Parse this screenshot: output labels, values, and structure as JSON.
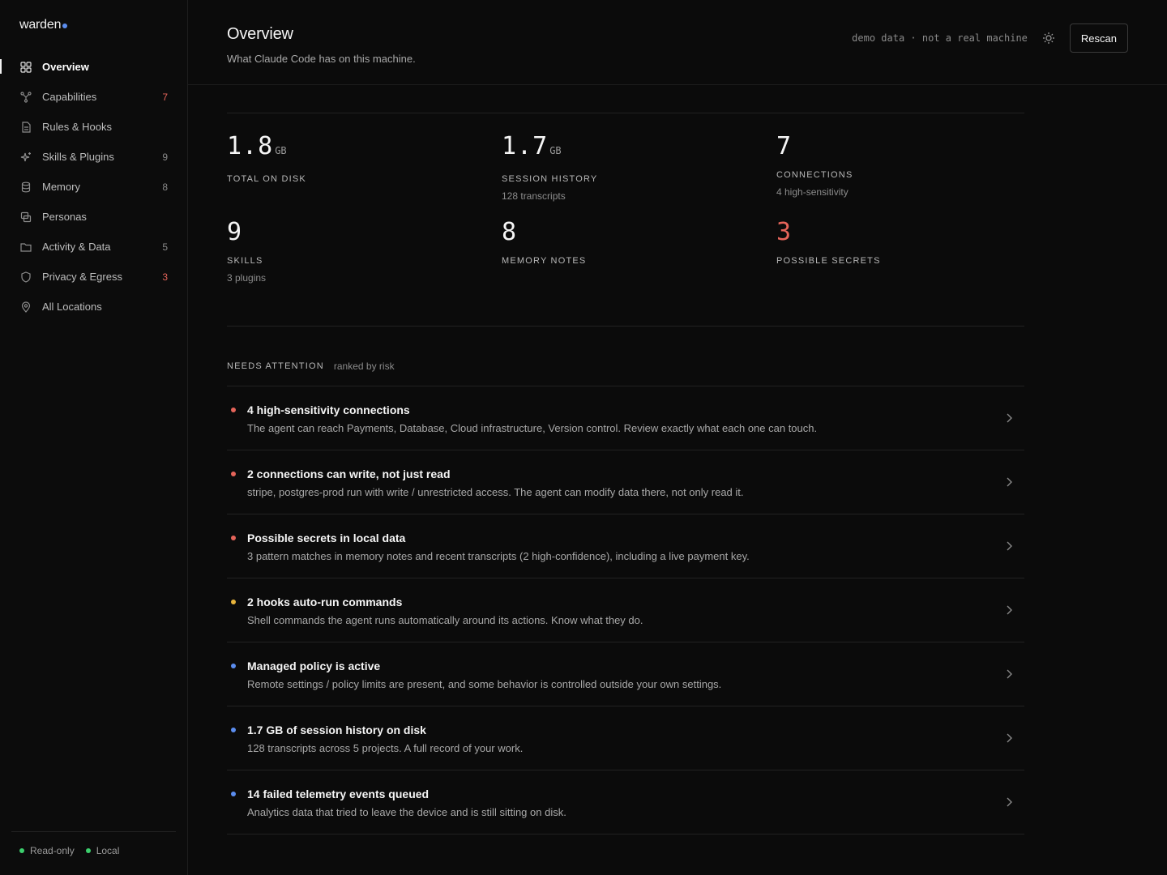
{
  "brand": {
    "name": "warden",
    "dot_color": "#5b8def"
  },
  "sidebar": {
    "items": [
      {
        "label": "Overview",
        "icon": "grid-icon",
        "count": "",
        "active": true
      },
      {
        "label": "Capabilities",
        "icon": "branch-icon",
        "count": "7",
        "alert": true
      },
      {
        "label": "Rules & Hooks",
        "icon": "document-icon",
        "count": ""
      },
      {
        "label": "Skills & Plugins",
        "icon": "sparkle-icon",
        "count": "9"
      },
      {
        "label": "Memory",
        "icon": "database-icon",
        "count": "8"
      },
      {
        "label": "Personas",
        "icon": "copy-icon",
        "count": ""
      },
      {
        "label": "Activity & Data",
        "icon": "folder-icon",
        "count": "5"
      },
      {
        "label": "Privacy & Egress",
        "icon": "shield-icon",
        "count": "3",
        "alert": true
      },
      {
        "label": "All Locations",
        "icon": "map-pin-icon",
        "count": ""
      }
    ],
    "footer": {
      "readonly": "Read-only",
      "local": "Local"
    }
  },
  "header": {
    "title": "Overview",
    "subtitle": "What Claude Code has on this machine.",
    "demo_note": "demo data · not a real machine",
    "rescan_label": "Rescan"
  },
  "stats": [
    {
      "value": "1.8",
      "unit": "GB",
      "label": "TOTAL ON DISK",
      "sub": ""
    },
    {
      "value": "1.7",
      "unit": "GB",
      "label": "SESSION HISTORY",
      "sub": "128 transcripts"
    },
    {
      "value": "7",
      "unit": "",
      "label": "CONNECTIONS",
      "sub": "4 high-sensitivity"
    },
    {
      "value": "9",
      "unit": "",
      "label": "SKILLS",
      "sub": "3 plugins"
    },
    {
      "value": "8",
      "unit": "",
      "label": "MEMORY NOTES",
      "sub": ""
    },
    {
      "value": "3",
      "unit": "",
      "label": "POSSIBLE SECRETS",
      "sub": "",
      "alert": true
    }
  ],
  "attention": {
    "title": "NEEDS ATTENTION",
    "subtitle": "ranked by risk",
    "items": [
      {
        "severity": "high",
        "title": "4 high-sensitivity connections",
        "desc": "The agent can reach Payments, Database, Cloud infrastructure, Version control. Review exactly what each one can touch."
      },
      {
        "severity": "high",
        "title": "2 connections can write, not just read",
        "desc": "stripe, postgres-prod run with write / unrestricted access. The agent can modify data there, not only read it."
      },
      {
        "severity": "high",
        "title": "Possible secrets in local data",
        "desc": "3 pattern matches in memory notes and recent transcripts (2 high-confidence), including a live payment key."
      },
      {
        "severity": "med",
        "title": "2 hooks auto-run commands",
        "desc": "Shell commands the agent runs automatically around its actions. Know what they do."
      },
      {
        "severity": "info",
        "title": "Managed policy is active",
        "desc": "Remote settings / policy limits are present, and some behavior is controlled outside your own settings."
      },
      {
        "severity": "info",
        "title": "1.7 GB of session history on disk",
        "desc": "128 transcripts across 5 projects. A full record of your work."
      },
      {
        "severity": "info",
        "title": "14 failed telemetry events queued",
        "desc": "Analytics data that tried to leave the device and is still sitting on disk."
      }
    ]
  },
  "colors": {
    "high": "#e5645a",
    "medium": "#e8b53c",
    "info": "#5b8def",
    "ok": "#3ccf6d"
  }
}
